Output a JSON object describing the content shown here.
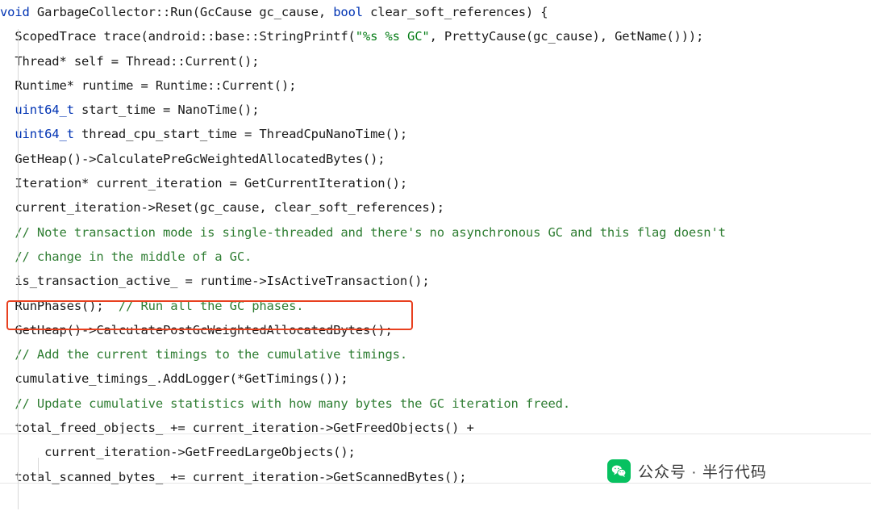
{
  "editor": {
    "language": "cpp",
    "font_size_px": 15.5,
    "background": "#ffffff",
    "default_text_color": "#222222",
    "keyword_color": "#0033b3",
    "string_color": "#067d17",
    "comment_color": "#2e7d32",
    "lines": [
      [
        {
          "t": "void",
          "c": "kw"
        },
        {
          "t": " GarbageCollector::Run(GcCause gc_cause, ",
          "c": "plain"
        },
        {
          "t": "bool",
          "c": "kw"
        },
        {
          "t": " clear_soft_references) {",
          "c": "plain"
        }
      ],
      [
        {
          "t": "  ScopedTrace trace(android::base::StringPrintf(",
          "c": "plain"
        },
        {
          "t": "\"%s %s GC\"",
          "c": "str"
        },
        {
          "t": ", PrettyCause(gc_cause), GetName()));",
          "c": "plain"
        }
      ],
      [
        {
          "t": "  Thread* self = Thread::Current();",
          "c": "plain"
        }
      ],
      [
        {
          "t": "  Runtime* runtime = Runtime::Current();",
          "c": "plain"
        }
      ],
      [
        {
          "t": "  ",
          "c": "plain"
        },
        {
          "t": "uint64_t",
          "c": "kw"
        },
        {
          "t": " start_time = NanoTime();",
          "c": "plain"
        }
      ],
      [
        {
          "t": "  ",
          "c": "plain"
        },
        {
          "t": "uint64_t",
          "c": "kw"
        },
        {
          "t": " thread_cpu_start_time = ThreadCpuNanoTime();",
          "c": "plain"
        }
      ],
      [
        {
          "t": "  GetHeap()->CalculatePreGcWeightedAllocatedBytes();",
          "c": "plain"
        }
      ],
      [
        {
          "t": "  Iteration* current_iteration = GetCurrentIteration();",
          "c": "plain"
        }
      ],
      [
        {
          "t": "  current_iteration->Reset(gc_cause, clear_soft_references);",
          "c": "plain"
        }
      ],
      [
        {
          "t": "  // Note transaction mode is single-threaded and there's no asynchronous GC and this flag doesn't",
          "c": "cmt"
        }
      ],
      [
        {
          "t": "  // change in the middle of a GC.",
          "c": "cmt"
        }
      ],
      [
        {
          "t": "  is_transaction_active_ = runtime->IsActiveTransaction();",
          "c": "plain"
        }
      ],
      [
        {
          "t": "  RunPhases();  ",
          "c": "plain"
        },
        {
          "t": "// Run all the GC phases.",
          "c": "cmt"
        }
      ],
      [
        {
          "t": "  GetHeap()->CalculatePostGcWeightedAllocatedBytes();",
          "c": "plain"
        }
      ],
      [
        {
          "t": "  // Add the current timings to the cumulative timings.",
          "c": "cmt"
        }
      ],
      [
        {
          "t": "  cumulative_timings_.AddLogger(*GetTimings());",
          "c": "plain"
        }
      ],
      [
        {
          "t": "  // Update cumulative statistics with how many bytes the GC iteration freed.",
          "c": "cmt"
        }
      ],
      [
        {
          "t": "  total_freed_objects_ += current_iteration->GetFreedObjects() +",
          "c": "plain"
        }
      ],
      [
        {
          "t": "      current_iteration->GetFreedLargeObjects();",
          "c": "plain"
        }
      ],
      [
        {
          "t": "  total_scanned_bytes_ += current_iteration->GetScannedBytes();",
          "c": "plain"
        }
      ]
    ]
  },
  "annotation": {
    "highlight_color": "#e8401f",
    "highlight_target_line_index": 12,
    "highlight_label": "RunPhases();  // Run all the GC phases."
  },
  "watermark": {
    "text": "公众号 · 半行代码",
    "badge_color": "#07c160",
    "badge_icon": "wechat-icon"
  }
}
